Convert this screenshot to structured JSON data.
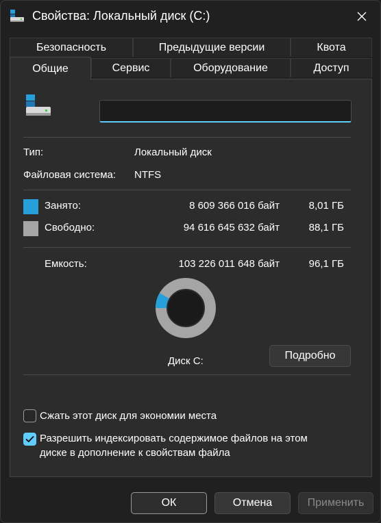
{
  "window": {
    "title": "Свойства: Локальный диск (C:)"
  },
  "tabs_row1": [
    {
      "label": "Безопасность"
    },
    {
      "label": "Предыдущие версии"
    },
    {
      "label": "Квота"
    }
  ],
  "tabs_row2": [
    {
      "label": "Общие",
      "active": true
    },
    {
      "label": "Сервис"
    },
    {
      "label": "Оборудование"
    },
    {
      "label": "Доступ"
    }
  ],
  "general": {
    "name_value": "",
    "type_label": "Тип:",
    "type_value": "Локальный диск",
    "fs_label": "Файловая система:",
    "fs_value": "NTFS",
    "used_label": "Занято:",
    "used_bytes": "8 609 366 016 байт",
    "used_size": "8,01 ГБ",
    "free_label": "Свободно:",
    "free_bytes": "94 616 645 632 байт",
    "free_size": "88,1 ГБ",
    "capacity_label": "Емкость:",
    "capacity_bytes": "103 226 011 648 байт",
    "capacity_size": "96,1 ГБ",
    "disk_label": "Диск C:",
    "details_button": "Подробно",
    "used_fraction": 0.0834,
    "used_color": "#26a0da",
    "free_color": "#a5a5a5"
  },
  "options": {
    "compress_label": "Сжать этот диск для экономии места",
    "compress_checked": false,
    "index_label_line1": "Разрешить индексировать содержимое файлов на этом",
    "index_label_line2": "диске в дополнение к свойствам файла",
    "index_checked": true
  },
  "buttons": {
    "ok": "ОК",
    "cancel": "Отмена",
    "apply": "Применить"
  }
}
